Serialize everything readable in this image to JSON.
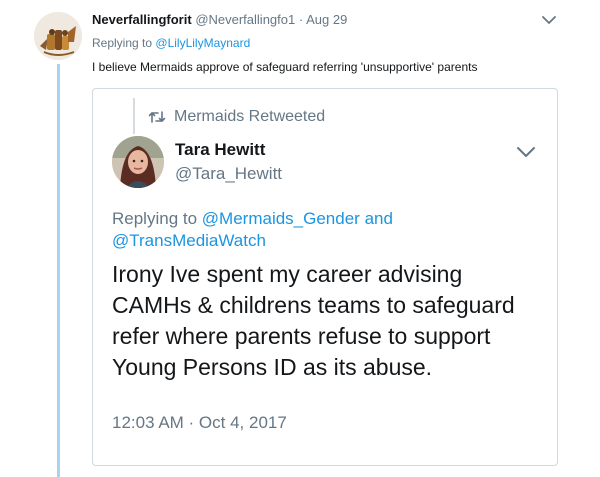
{
  "outer_tweet": {
    "display_name": "Neverfallingforit",
    "handle": "@Neverfallingfo1",
    "separator": "·",
    "date": "Aug 29",
    "replying_prefix": "Replying to",
    "replying_to": "@LilyLilyMaynard",
    "text": "I believe Mermaids approve of safeguard referring 'unsupportive' parents",
    "menu_icon": "chevron-down-icon",
    "avatar_icon": "avatar"
  },
  "quoted_tweet": {
    "retweet_label": "Mermaids Retweeted",
    "retweet_icon": "retweet-icon",
    "display_name": "Tara Hewitt",
    "handle": "@Tara_Hewitt",
    "replying_prefix": "Replying to",
    "replying_to_1": "@Mermaids_Gender",
    "replying_and": "and",
    "replying_to_2": "@TransMediaWatch",
    "text_lines": [
      "Irony Ive spent my career advising",
      "CAMHs & childrens teams to safeguard",
      "refer where parents refuse to support",
      "Young Persons ID as its abuse."
    ],
    "timestamp": "12:03 AM · Oct 4, 2017",
    "menu_icon": "chevron-down-icon"
  },
  "colors": {
    "link": "#1b95e0",
    "secondary_text": "#657786",
    "thread_line": "#a9d4f0",
    "border": "#cfd9de"
  }
}
